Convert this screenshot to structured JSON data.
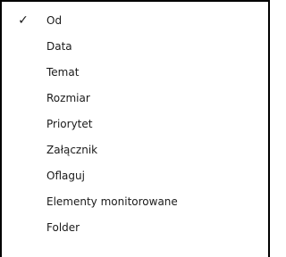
{
  "menu": {
    "check_glyph": "✓",
    "check_icon": "checkmark-icon",
    "items": [
      {
        "label": "Od",
        "checked": true
      },
      {
        "label": "Data",
        "checked": false
      },
      {
        "label": "Temat",
        "checked": false
      },
      {
        "label": "Rozmiar",
        "checked": false
      },
      {
        "label": "Priorytet",
        "checked": false
      },
      {
        "label": "Załącznik",
        "checked": false
      },
      {
        "label": "Oflaguj",
        "checked": false
      },
      {
        "label": "Elementy monitorowane",
        "checked": false
      },
      {
        "label": "Folder",
        "checked": false
      }
    ]
  }
}
